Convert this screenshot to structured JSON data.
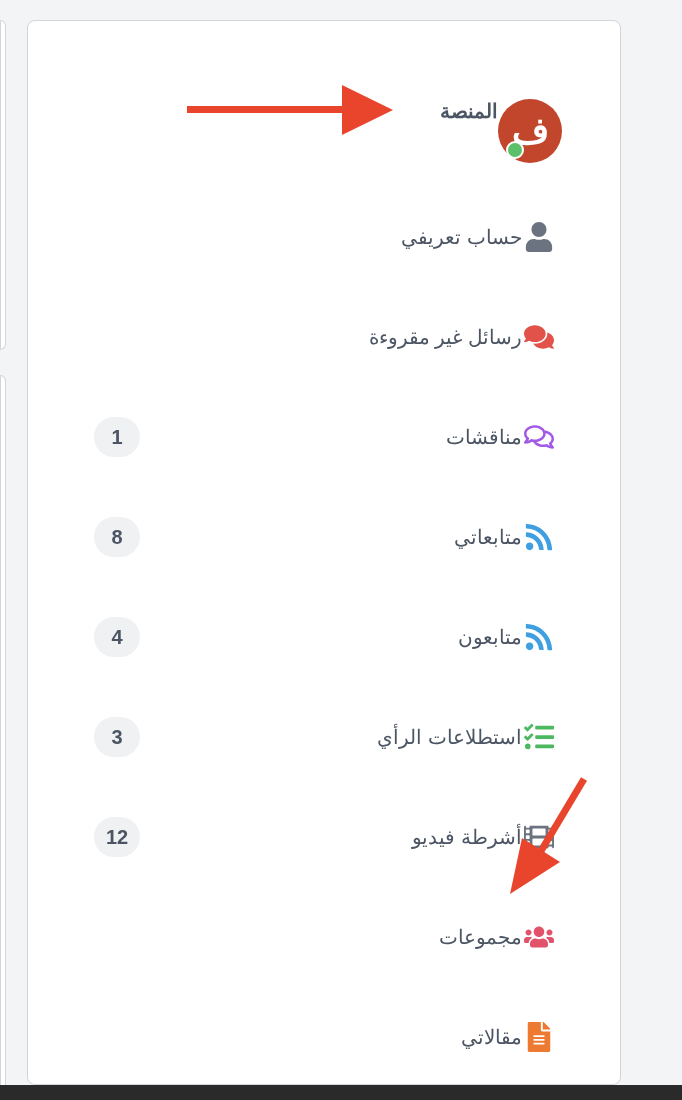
{
  "header": {
    "title": "المنصة",
    "avatar_letter": "ف",
    "online": true
  },
  "menu": [
    {
      "kind": "user",
      "color": "#6b7280",
      "label": "حساب تعريفي"
    },
    {
      "kind": "chat",
      "color": "#e0524a",
      "label": "رسائل غير مقروءة"
    },
    {
      "kind": "chat-outline",
      "color": "#a259e6",
      "label": "مناقشات",
      "count": "1"
    },
    {
      "kind": "rss",
      "color": "#3f9fe0",
      "label": "متابعاتي",
      "count": "8"
    },
    {
      "kind": "rss",
      "color": "#3f9fe0",
      "label": "متابعون",
      "count": "4"
    },
    {
      "kind": "tasks",
      "color": "#4cb860",
      "label": "استطلاعات الرأي",
      "count": "3"
    },
    {
      "kind": "film",
      "color": "#6b7280",
      "label": "أشرطة فيديو",
      "count": "12"
    },
    {
      "kind": "users",
      "color": "#e2526a",
      "label": "مجموعات"
    },
    {
      "kind": "file",
      "color": "#ee7a32",
      "label": "مقالاتي"
    }
  ]
}
